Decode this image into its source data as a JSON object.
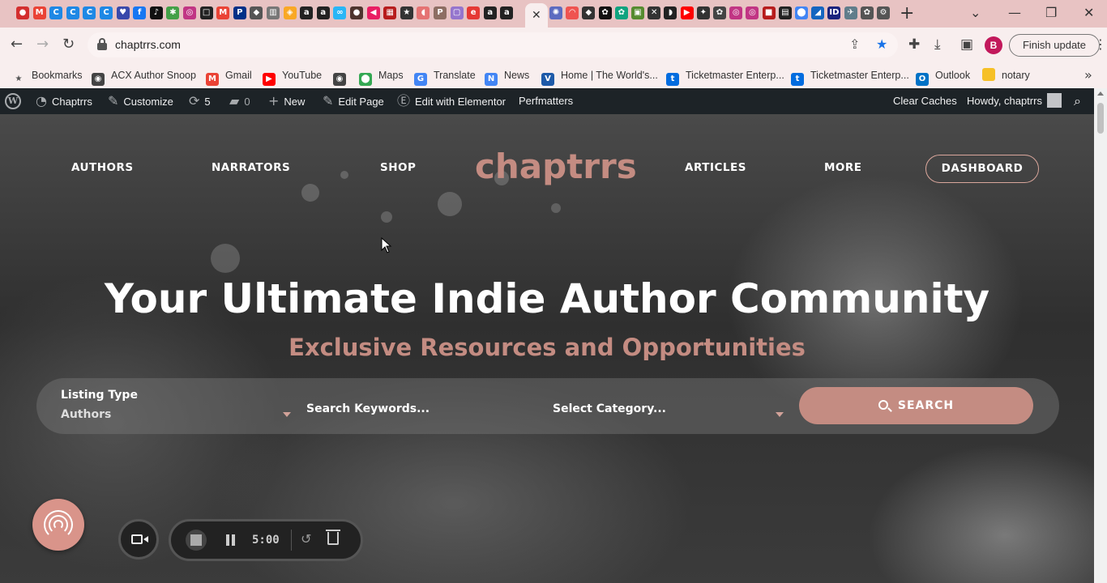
{
  "browser": {
    "address_url": "chaptrrs.com",
    "finish_update_label": "Finish update",
    "profile_initial": "B",
    "tab_icons": [
      {
        "name": "opera-icon",
        "color": "#d32f2f",
        "glyph": "●"
      },
      {
        "name": "gmail-icon",
        "color": "#ea4335",
        "glyph": "M"
      },
      {
        "name": "c-app-icon",
        "color": "#1e88e5",
        "glyph": "C"
      },
      {
        "name": "c-app-icon",
        "color": "#1e88e5",
        "glyph": "C"
      },
      {
        "name": "c-app-icon",
        "color": "#1e88e5",
        "glyph": "C"
      },
      {
        "name": "c-app-icon",
        "color": "#1e88e5",
        "glyph": "C"
      },
      {
        "name": "heart-app-icon",
        "color": "#3949ab",
        "glyph": "♥"
      },
      {
        "name": "facebook-icon",
        "color": "#1877f2",
        "glyph": "f"
      },
      {
        "name": "tiktok-icon",
        "color": "#111111",
        "glyph": "♪"
      },
      {
        "name": "asterisk-icon",
        "color": "#43a047",
        "glyph": "✱"
      },
      {
        "name": "instagram-icon",
        "color": "#c13584",
        "glyph": "◎"
      },
      {
        "name": "square-app-icon",
        "color": "#222222",
        "glyph": "□"
      },
      {
        "name": "gmail-icon",
        "color": "#ea4335",
        "glyph": "M"
      },
      {
        "name": "paypal-icon",
        "color": "#003087",
        "glyph": "P"
      },
      {
        "name": "cat-icon",
        "color": "#555555",
        "glyph": "◆"
      },
      {
        "name": "chart-app-icon",
        "color": "#777777",
        "glyph": "▥"
      },
      {
        "name": "book-app-icon",
        "color": "#f9a825",
        "glyph": "◈"
      },
      {
        "name": "amazon-icon",
        "color": "#222222",
        "glyph": "a"
      },
      {
        "name": "amazon-icon",
        "color": "#222222",
        "glyph": "a"
      },
      {
        "name": "infinity-icon",
        "color": "#29b6f6",
        "glyph": "∞"
      },
      {
        "name": "dark-circle-icon",
        "color": "#4e342e",
        "glyph": "●"
      },
      {
        "name": "pink-app-icon",
        "color": "#e91e63",
        "glyph": "◀"
      },
      {
        "name": "news-app-icon",
        "color": "#b71c1c",
        "glyph": "▦"
      },
      {
        "name": "star-app-icon",
        "color": "#333333",
        "glyph": "★"
      },
      {
        "name": "pin-app-icon",
        "color": "#e57373",
        "glyph": "◖"
      },
      {
        "name": "p-app-icon",
        "color": "#8d6e63",
        "glyph": "P"
      },
      {
        "name": "lavender-app-icon",
        "color": "#9575cd",
        "glyph": "▢"
      },
      {
        "name": "e-app-icon",
        "color": "#e53935",
        "glyph": "e"
      },
      {
        "name": "amazon-icon",
        "color": "#222222",
        "glyph": "a"
      },
      {
        "name": "amazon-icon",
        "color": "#222222",
        "glyph": "a"
      }
    ],
    "tab_icons_right": [
      {
        "name": "gear-flower-icon",
        "color": "#5c6bc0",
        "glyph": "✺"
      },
      {
        "name": "rainbow-icon",
        "color": "#ef5350",
        "glyph": "◠"
      },
      {
        "name": "diamond-icon",
        "color": "#333333",
        "glyph": "◆"
      },
      {
        "name": "openai-icon",
        "color": "#111111",
        "glyph": "✿"
      },
      {
        "name": "openai-icon",
        "color": "#10a37f",
        "glyph": "✿"
      },
      {
        "name": "green-app-icon",
        "color": "#558b2f",
        "glyph": "▣"
      },
      {
        "name": "cross-app-icon",
        "color": "#333333",
        "glyph": "✕"
      },
      {
        "name": "shield-icon",
        "color": "#222222",
        "glyph": "◗"
      },
      {
        "name": "youtube-icon",
        "color": "#ff0000",
        "glyph": "▶"
      },
      {
        "name": "puzzle-app-icon",
        "color": "#333333",
        "glyph": "✦"
      },
      {
        "name": "openai-icon",
        "color": "#444444",
        "glyph": "✿"
      },
      {
        "name": "instagram-icon",
        "color": "#c13584",
        "glyph": "◎"
      },
      {
        "name": "instagram-icon",
        "color": "#c13584",
        "glyph": "◎"
      },
      {
        "name": "red-box-icon",
        "color": "#b71c1c",
        "glyph": "■"
      },
      {
        "name": "notebook-icon",
        "color": "#212121",
        "glyph": "▤"
      },
      {
        "name": "maps-pin-icon",
        "color": "#4285f4",
        "glyph": "⬤"
      },
      {
        "name": "trend-icon",
        "color": "#1565c0",
        "glyph": "◢"
      },
      {
        "name": "id-icon",
        "color": "#1a237e",
        "glyph": "ID"
      },
      {
        "name": "plane-icon",
        "color": "#607d8b",
        "glyph": "✈"
      },
      {
        "name": "openai-icon",
        "color": "#555555",
        "glyph": "✿"
      },
      {
        "name": "gear-icon",
        "color": "#555555",
        "glyph": "⚙"
      }
    ]
  },
  "bookmarks": [
    {
      "label": "Bookmarks",
      "icon": "star-icon",
      "color": "#555555",
      "glyph": "★"
    },
    {
      "label": "ACX Author Snoop",
      "icon": "globe-icon",
      "color": "#444444",
      "glyph": "◉"
    },
    {
      "label": "Gmail",
      "icon": "gmail-icon",
      "color": "#ea4335",
      "glyph": "M"
    },
    {
      "label": "YouTube",
      "icon": "youtube-icon",
      "color": "#ff0000",
      "glyph": "▶"
    },
    {
      "label": "",
      "icon": "globe-icon",
      "color": "#444444",
      "glyph": "◉"
    },
    {
      "label": "Maps",
      "icon": "maps-pin-icon",
      "color": "#34a853",
      "glyph": "⬤"
    },
    {
      "label": "Translate",
      "icon": "translate-icon",
      "color": "#4285f4",
      "glyph": "G"
    },
    {
      "label": "News",
      "icon": "news-icon",
      "color": "#4285f4",
      "glyph": "N"
    },
    {
      "label": "Home | The World's...",
      "icon": "v-icon",
      "color": "#1e5aa8",
      "glyph": "V"
    },
    {
      "label": "Ticketmaster Enterp...",
      "icon": "t-icon",
      "color": "#026cdf",
      "glyph": "t"
    },
    {
      "label": "Ticketmaster Enterp...",
      "icon": "t-icon",
      "color": "#026cdf",
      "glyph": "t"
    },
    {
      "label": "Outlook",
      "icon": "outlook-icon",
      "color": "#0072c6",
      "glyph": "O"
    },
    {
      "label": "notary",
      "icon": "folder-icon",
      "color": "#f6c026",
      "glyph": ""
    }
  ],
  "wp_admin_bar": {
    "site_name": "Chaptrrs",
    "customize": "Customize",
    "updates_count": "5",
    "comments_count": "0",
    "new": "New",
    "edit_page": "Edit Page",
    "edit_elementor": "Edit with Elementor",
    "perfmatters": "Perfmatters",
    "clear_caches": "Clear Caches",
    "howdy": "Howdy, chaptrrs"
  },
  "site": {
    "logo": "chaptrrs",
    "nav": {
      "authors": "AUTHORS",
      "narrators": "NARRATORS",
      "shop": "SHOP",
      "articles": "ARTICLES",
      "more": "MORE",
      "dashboard": "DASHBOARD"
    },
    "headline": "Your Ultimate Indie Author Community",
    "subheadline": "Exclusive Resources and Opportunities",
    "search": {
      "listing_type_label": "Listing Type",
      "listing_type_value": "Authors",
      "keywords_placeholder": "Search Keywords...",
      "category_placeholder": "Select Category...",
      "button_label": "SEARCH"
    },
    "accent_color": "#c48c82"
  },
  "recorder": {
    "timer": "5:00"
  }
}
